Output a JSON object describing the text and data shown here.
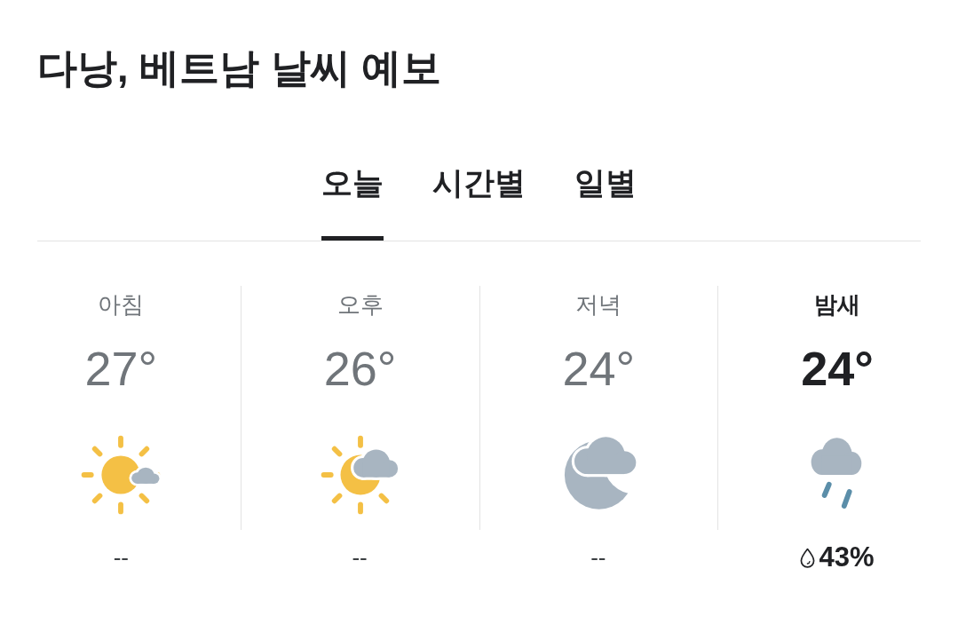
{
  "title": "다낭, 베트남 날씨 예보",
  "tabs": [
    {
      "label": "오늘",
      "selected": true
    },
    {
      "label": "시간별",
      "selected": false
    },
    {
      "label": "일별",
      "selected": false
    }
  ],
  "periods": [
    {
      "label": "아침",
      "temperature": "27°",
      "kind": "sunny",
      "selected": false,
      "precipitation": {
        "kind": "none",
        "text": "--"
      }
    },
    {
      "label": "오후",
      "temperature": "26°",
      "kind": "suncloud",
      "selected": false,
      "precipitation": {
        "kind": "none",
        "text": "--"
      }
    },
    {
      "label": "저녁",
      "temperature": "24°",
      "kind": "nightcloud",
      "selected": false,
      "precipitation": {
        "kind": "none",
        "text": "--"
      }
    },
    {
      "label": "밤새",
      "temperature": "24°",
      "kind": "rain",
      "selected": true,
      "precipitation": {
        "kind": "chance",
        "text": "43%"
      }
    }
  ]
}
